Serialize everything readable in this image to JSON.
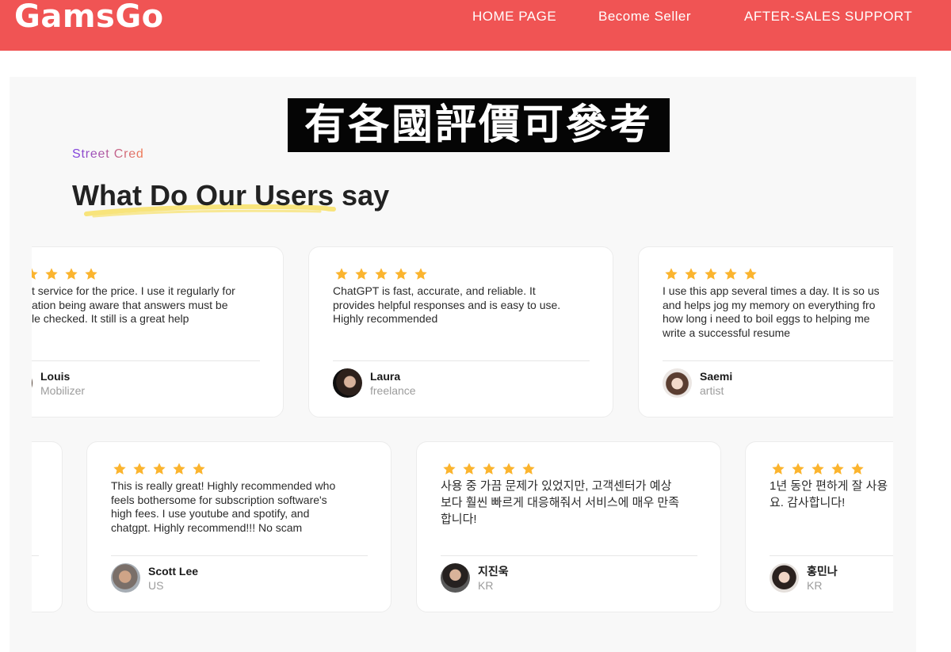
{
  "theme": {
    "brand_red": "#F05454",
    "star": "#FBB42E",
    "highlight": "#F8E47B",
    "eyebrow_from": "#7B3FE4",
    "eyebrow_to": "#F27B52"
  },
  "header": {
    "logo_text": "GamsGo",
    "nav": [
      {
        "label": "HOME PAGE"
      },
      {
        "label": "Become Seller"
      },
      {
        "label": "AFTER-SALES SUPPORT"
      }
    ]
  },
  "overlay_caption": "有各國評價可參考",
  "section": {
    "eyebrow": "Street Cred",
    "title": "What Do Our Users say"
  },
  "testimonials": {
    "row1": [
      {
        "rating": 5,
        "lines": [
          "t service for the price. I use it regularly for",
          "ation being aware that answers must be",
          "le checked. It still is a great help"
        ],
        "name": "Louis",
        "role": "Mobilizer"
      },
      {
        "rating": 5,
        "lines": [
          "ChatGPT is fast, accurate, and reliable. It",
          "provides helpful responses and is easy to use.",
          "Highly recommended"
        ],
        "name": "Laura",
        "role": "freelance"
      },
      {
        "rating": 5,
        "lines": [
          "I use this app several times a day. It is so us",
          "and helps jog my memory on everything fro",
          "how long i need to boil eggs to helping me",
          "write a successful resume"
        ],
        "name": "Saemi",
        "role": "artist"
      }
    ],
    "row2": [
      {
        "rating": 5,
        "lines": [
          "This is really great! Highly recommended who",
          "feels bothersome for subscription software's",
          "high fees. I use youtube and spotify, and",
          "chatgpt. Highly recommend!!! No scam"
        ],
        "name": "Scott Lee",
        "role": "US"
      },
      {
        "rating": 5,
        "lines": [
          "사용 중 가끔 문제가 있었지만, 고객센터가 예상",
          "보다 훨씬 빠르게 대응해줘서 서비스에 매우 만족",
          "합니다!"
        ],
        "name": "지진욱",
        "role": "KR"
      },
      {
        "rating": 5,
        "lines": [
          "1년 동안 편하게 잘 사용",
          "요. 감사합니다!"
        ],
        "name": "홍민나",
        "role": "KR"
      }
    ]
  }
}
